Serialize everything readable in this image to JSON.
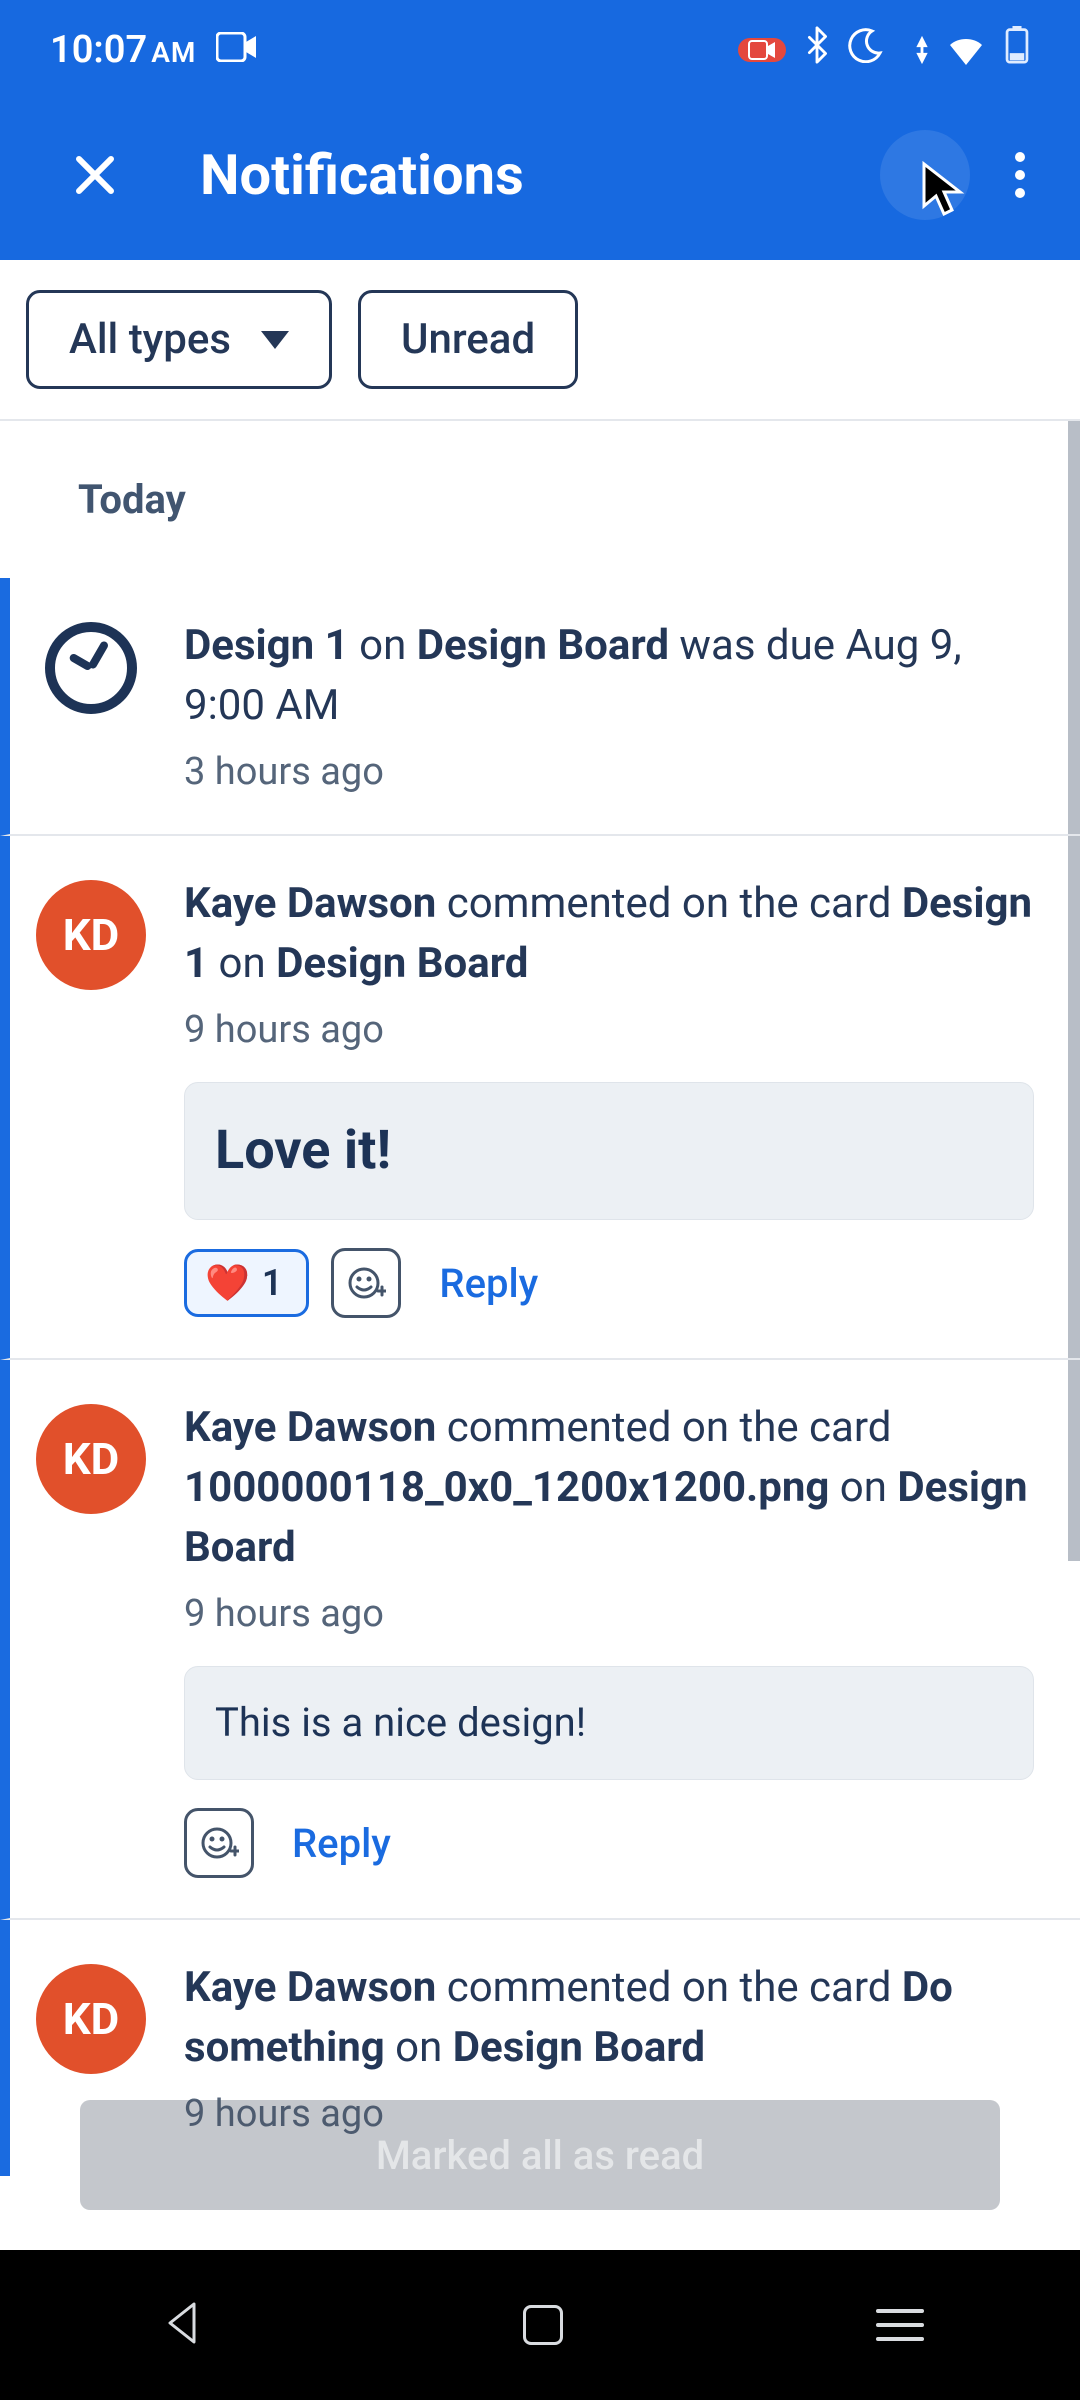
{
  "status": {
    "time": "10:07",
    "ampm": "AM"
  },
  "header": {
    "title": "Notifications"
  },
  "filters": {
    "type_label": "All types",
    "unread_label": "Unread"
  },
  "list": {
    "day": "Today",
    "items": [
      {
        "kind": "due",
        "card": "Design 1",
        "mid1": " on ",
        "board": "Design Board",
        "tail": " was due Aug 9, 9:00 AM",
        "timestamp": "3 hours ago"
      },
      {
        "kind": "comment",
        "avatar": "KD",
        "actor": "Kaye Dawson",
        "mid0": " commented on the card ",
        "card": "Design 1",
        "mid1": " on ",
        "board": "Design Board",
        "timestamp": "9 hours ago",
        "quote": "Love it!",
        "reaction_emoji": "❤️",
        "reaction_count": "1",
        "reply_label": "Reply"
      },
      {
        "kind": "comment",
        "avatar": "KD",
        "actor": "Kaye Dawson",
        "mid0": " commented on the card ",
        "card": "1000000118_0x0_1200x1200.png",
        "mid1": " on ",
        "board": "Design Board",
        "timestamp": "9 hours ago",
        "quote_pre": "This is a nice ",
        "quote_bold": "design",
        "quote_post": "!",
        "reply_label": "Reply"
      },
      {
        "kind": "comment",
        "avatar": "KD",
        "actor": "Kaye Dawson",
        "mid0": " commented on the card ",
        "card": "Do something",
        "mid1": " on ",
        "board": "Design Board",
        "timestamp": "9 hours ago"
      }
    ]
  },
  "toast": {
    "text": "Marked all as read"
  }
}
